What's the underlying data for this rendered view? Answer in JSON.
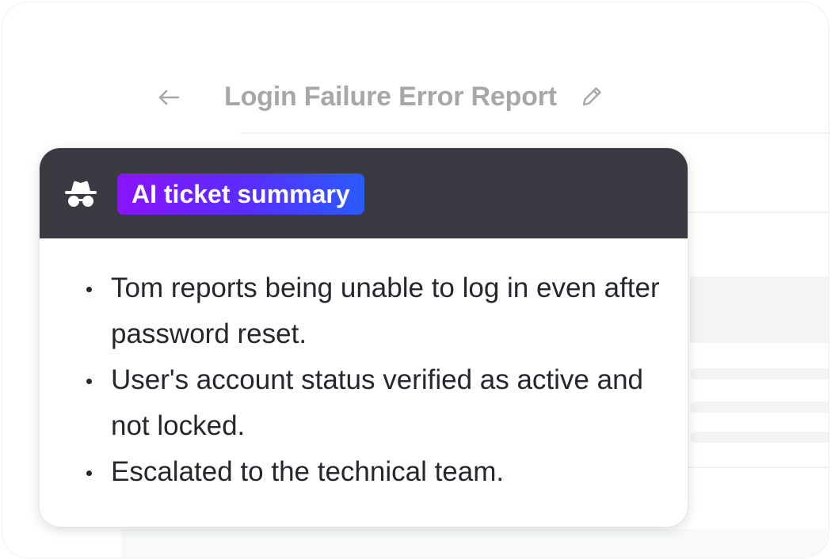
{
  "ticket": {
    "title": "Login Failure Error Report",
    "back_icon": "arrow-left-icon",
    "edit_icon": "pencil-icon"
  },
  "summary_card": {
    "icon": "spy-icon",
    "badge_label": "AI ticket summary",
    "badge_gradient": [
      "#8a14ff",
      "#2a5bff"
    ],
    "header_color": "#3a3a43",
    "items": [
      "Tom reports being unable to log in even after password reset.",
      "User's account status verified as active and not locked.",
      "Escalated to the technical team."
    ]
  }
}
